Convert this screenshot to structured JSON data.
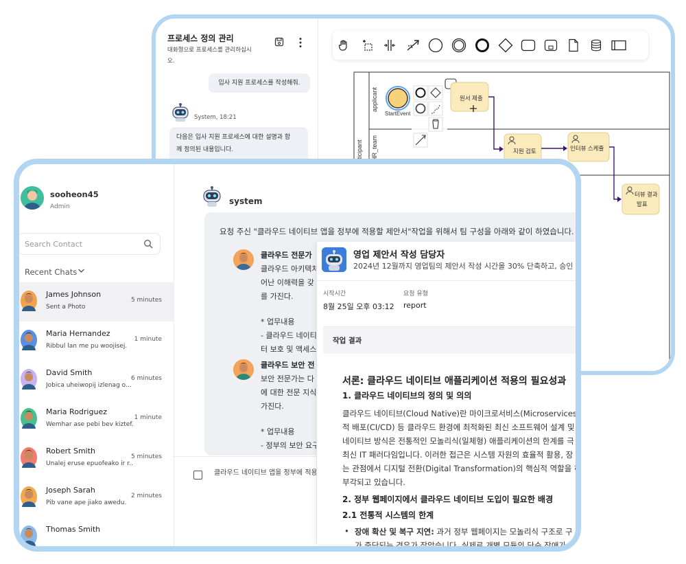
{
  "process_panel": {
    "title": "프로세스 정의 관리",
    "subtitle_line1": "대화형으로 프로세스를 관리하십시",
    "subtitle_line2": "오.",
    "user_message": "입사 지원 프로세스를 작성해줘.",
    "system_meta": "System, 18:21",
    "system_message_line1": "다음은 입사 지원 프로세스에 대한 설명과 함",
    "system_message_line2": "께 정의된 내용입니다.",
    "toolbar_icons": [
      "hand-icon",
      "lasso-icon",
      "space-tool-icon",
      "connect-icon",
      "start-event-icon",
      "intermediate-event-icon",
      "end-event-icon",
      "gateway-icon",
      "task-icon",
      "subprocess-icon",
      "data-object-icon",
      "data-store-icon",
      "pool-icon"
    ],
    "diagram": {
      "lane1": "applicant",
      "lane2a": "participant",
      "lane2b": "HR_team",
      "start_event_label": "StartEvent",
      "task1": "원서 제출",
      "task2": "지원 검토",
      "task3": "인터뷰 스케쥴",
      "task4_line1": "터뷰 결과",
      "task4_line2": "발표"
    }
  },
  "chat_app": {
    "user": {
      "name": "sooheon45",
      "role": "Admin"
    },
    "search_placeholder": "Search Contact",
    "recent_chats_label": "Recent Chats",
    "chats": [
      {
        "name": "James Johnson",
        "message": "Sent a Photo",
        "time": "5 minutes",
        "color": "#f0a24e"
      },
      {
        "name": "Maria Hernandez",
        "message": "Ribbul lan me pu woojisej.",
        "time": "1 minute",
        "color": "#5b8de0"
      },
      {
        "name": "David Smith",
        "message": "Jobica uheiwopij izlenag o...",
        "time": "6 minutes",
        "color": "#c9b2f2"
      },
      {
        "name": "Maria Rodriguez",
        "message": "Wemhar ase pebi bev kiztef...",
        "time": "1 minute",
        "color": "#47c08e"
      },
      {
        "name": "Robert Smith",
        "message": "Unalej eruse epuofeako ir r...",
        "time": "5 minutes",
        "color": "#ef7c6c"
      },
      {
        "name": "Joseph Sarah",
        "message": "Pib vane ape jiako awedu.",
        "time": "2 minutes",
        "color": "#f3a74f"
      },
      {
        "name": "Thomas Smith",
        "message": "",
        "time": "",
        "color": "#8bb8e6"
      }
    ],
    "sender": "system",
    "request_text": "요청 주신 \"클라우드 네이티브 앱을 정부에 적용할 제안서\"작업을 위해서 팀 구성을 아래와 같이 하였습니다.",
    "member1": {
      "role": "클라우드 전문가",
      "lines": [
        "클라우드 아키텍처",
        "어난 이해력을 갖",
        "를 가진다.",
        "",
        "* 업무내용",
        "- 클라우드 네이티",
        "터 보호 및 액세스"
      ]
    },
    "member2": {
      "role": "클라우드 보안 전",
      "lines": [
        "보안 전문가는 다",
        "에 대한 전문 지식",
        "가진다.",
        "",
        "* 업무내용",
        "- 정부의 보안 요구"
      ]
    },
    "input_text": "클라우드 네이티브 앱을 정부에 적용",
    "card": {
      "title": "영업 제안서 작성 담당자",
      "subtitle": "2024년 12월까지 영업팀의 제안서 작성 시간을 30% 단축하고, 승인",
      "start_time_label": "시작시간",
      "start_time_value": "8월 25일 오후 03:12",
      "request_type_label": "요청 유형",
      "request_type_value": "report",
      "result_label": "작업 결과",
      "doc": {
        "h1": "서론: 클라우드 네이티브 애플리케이션 적용의 필요성과",
        "s1": "1. 클라우드 네이티브의 정의 및 의의",
        "p1": [
          "클라우드 네이티브(Cloud Native)란 마이크로서비스(Microservices), 컨",
          "적 배포(CI/CD) 등 클라우드 환경에 최적화된 최신 소프트웨어 설계 및",
          "네이티브 방식은 전통적인 모놀리식(일체형) 애플리케이션의 한계를 극",
          "최신 IT 패러다임입니다. 이러한 접근은 시스템 자원의 효율적 활용, 장",
          "는 관점에서 디지털 전환(Digital Transformation)의 핵심적 역할을 하",
          "부각되고 있습니다."
        ],
        "s2": "2. 정부 웹페이지에서 클라우드 네이티브 도입이 필요한 배경",
        "s21": "2.1 전통적 시스템의 한계",
        "b1_bold": "장애 확산 및 복구 지연:",
        "b1_rest": " 과거 정부 웹페이지는 모놀리식 구조로 구",
        "b1_line2": "가 중단되는 경우가 잦았습니다. 실제로 개별 모듈의 단순 장애가"
      }
    }
  }
}
